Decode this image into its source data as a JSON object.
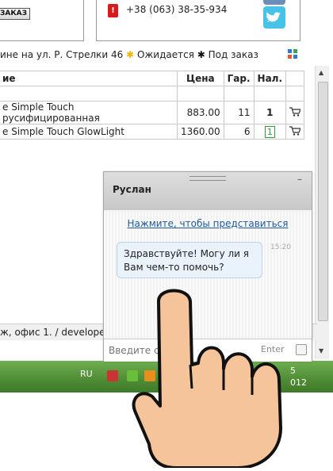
{
  "header": {
    "order_button": "ЗАКАЗ",
    "phone": "+38 (063) 38-35-934",
    "phone_icon": "phone-icon",
    "social_icons": [
      "vk-icon",
      "twitter-icon"
    ]
  },
  "legend": {
    "text1": "ине на ул. Р. Стрелки 46",
    "text2": "Ожидается",
    "text3": "Под заказ"
  },
  "table": {
    "headers": [
      "ие",
      "Цена",
      "Гар.",
      "Нал.",
      ""
    ],
    "rows": [
      {
        "name": "e Simple Touch русифицированная",
        "price": "883.00",
        "warranty": "11",
        "stock": "1"
      },
      {
        "name": "e Simple Touch GlowLight",
        "price": "1360.00",
        "warranty": "6",
        "stock": "1"
      }
    ]
  },
  "status_line": "ж, офис 1. / develope",
  "taskbar": {
    "lang": "RU",
    "clock_line1": "5",
    "clock_line2": "012"
  },
  "chat": {
    "operator": "Руслан",
    "minimize": "–",
    "intro_link": "Нажмите, чтобы представиться",
    "message": "Здравствуйте! Могу ли я Вам чем-то помочь?",
    "time": "15:20",
    "input_placeholder": "Введите с",
    "enter_label": "Enter"
  },
  "colors": {
    "taskbar": "#4f8c35",
    "link": "#1f5a9e",
    "stock_green": "#2e9e3a",
    "phone_red": "#d81a1a"
  }
}
